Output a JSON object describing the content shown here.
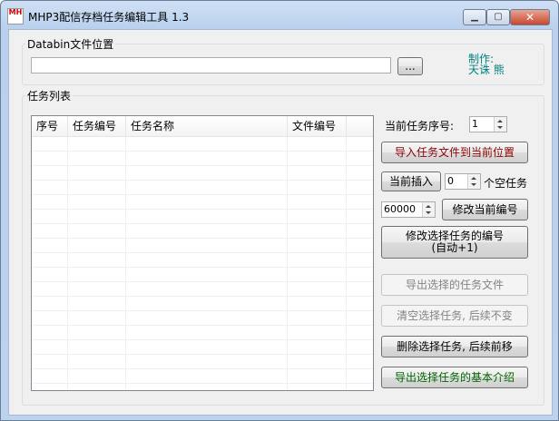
{
  "window": {
    "title": "MHP3配信存档任务编辑工具 1.3",
    "app_icon_text": "MH"
  },
  "databin": {
    "group_label": "Databin文件位置",
    "path_value": "",
    "browse_label": "..."
  },
  "credit": {
    "line1": "制作:",
    "line2": "天诛 熊"
  },
  "task_list": {
    "group_label": "任务列表",
    "columns": [
      "序号",
      "任务编号",
      "任务名称",
      "文件编号"
    ]
  },
  "controls": {
    "current_index_label": "当前任务序号:",
    "current_index_value": "1",
    "import_label": "导入任务文件到当前位置",
    "insert_label": "当前插入",
    "insert_count_value": "0",
    "empty_tasks_label": "个空任务",
    "number_value": "60000",
    "modify_current_label": "修改当前编号",
    "modify_selected_line1": "修改选择任务的编号",
    "modify_selected_line2": "(自动+1)",
    "export_selected_label": "导出选择的任务文件",
    "clear_selected_label": "清空选择任务, 后续不变",
    "delete_selected_label": "删除选择任务, 后续前移",
    "export_intro_label": "导出选择任务的基本介绍"
  },
  "colors": {
    "import_text": "#8b0000",
    "export_intro_text": "#006400",
    "credit_text": "#008080"
  }
}
